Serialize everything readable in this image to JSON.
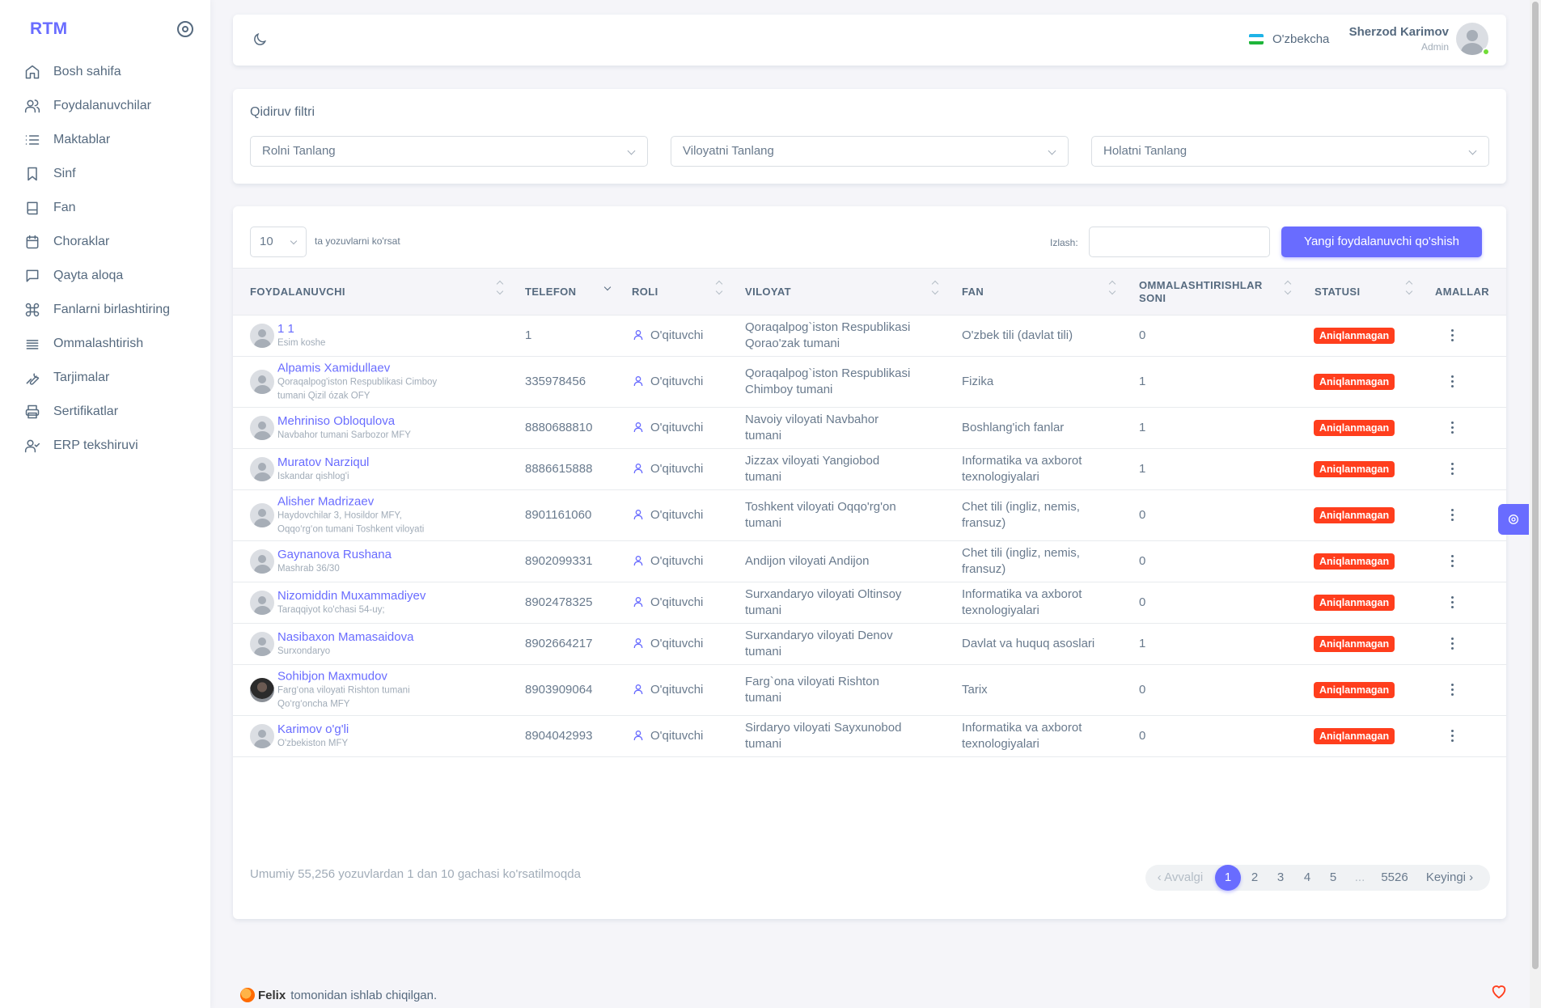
{
  "brand": "RTM",
  "sidebar": {
    "items": [
      {
        "label": "Bosh sahifa",
        "icon": "home-icon"
      },
      {
        "label": "Foydalanuvchilar",
        "icon": "users-icon"
      },
      {
        "label": "Maktablar",
        "icon": "list-icon"
      },
      {
        "label": "Sinf",
        "icon": "bookmark-icon"
      },
      {
        "label": "Fan",
        "icon": "book-icon"
      },
      {
        "label": "Choraklar",
        "icon": "calendar-icon"
      },
      {
        "label": "Qayta aloqa",
        "icon": "message-icon"
      },
      {
        "label": "Fanlarni birlashtiring",
        "icon": "command-icon"
      },
      {
        "label": "Ommalashtirish",
        "icon": "menu-icon"
      },
      {
        "label": "Tarjimalar",
        "icon": "tool-icon"
      },
      {
        "label": "Sertifikatlar",
        "icon": "printer-icon"
      },
      {
        "label": "ERP tekshiruvi",
        "icon": "user-check-icon"
      }
    ]
  },
  "navbar": {
    "language": "O'zbekcha",
    "user_name": "Sherzod Karimov",
    "user_role": "Admin"
  },
  "filters": {
    "title": "Qidiruv filtri",
    "role_placeholder": "Rolni Tanlang",
    "region_placeholder": "Viloyatni Tanlang",
    "status_placeholder": "Holatni Tanlang"
  },
  "table": {
    "page_length": "10",
    "page_length_label": "ta yozuvlarni ko'rsat",
    "search_label": "Izlash:",
    "add_button": "Yangi foydalanuvchi qo'shish",
    "columns": {
      "user": "FOYDALANUVCHI",
      "phone": "TELEFON",
      "role": "ROLI",
      "region": "VILOYAT",
      "subject": "FAN",
      "publications_1": "OMMALASHTIRISHLAR",
      "publications_2": "SONI",
      "status": "STATUSI",
      "actions": "AMALLAR"
    },
    "rows": [
      {
        "name": "1 1",
        "addr1": "Esim koshe",
        "addr2": "",
        "phone": "1",
        "role": "O'qituvchi",
        "region1": "Qoraqalpog`iston Respublikasi",
        "region2": "Qorao'zak tumani",
        "subject1": "O'zbek tili (davlat tili)",
        "subject2": "",
        "count": "0",
        "status": "Aniqlanmagan"
      },
      {
        "name": "Alpamis Xamidullaev",
        "addr1": "Qoraqalpog'iston Respublikasi Cimboy",
        "addr2": "tumani Qizil ózak OFY",
        "phone": "335978456",
        "role": "O'qituvchi",
        "region1": "Qoraqalpog`iston Respublikasi",
        "region2": "Chimboy tumani",
        "subject1": "Fizika",
        "subject2": "",
        "count": "1",
        "status": "Aniqlanmagan"
      },
      {
        "name": "Mehriniso Obloqulova",
        "addr1": "Navbahor tumani Sarbozor MFY",
        "addr2": "",
        "phone": "8880688810",
        "role": "O'qituvchi",
        "region1": "Navoiy viloyati Navbahor",
        "region2": "tumani",
        "subject1": "Boshlang'ich fanlar",
        "subject2": "",
        "count": "1",
        "status": "Aniqlanmagan"
      },
      {
        "name": "Muratov Narziqul",
        "addr1": "Iskandar qishlog'i",
        "addr2": "",
        "phone": "8886615888",
        "role": "O'qituvchi",
        "region1": "Jizzax viloyati Yangiobod",
        "region2": "tumani",
        "subject1": "Informatika va axborot",
        "subject2": "texnologiyalari",
        "count": "1",
        "status": "Aniqlanmagan"
      },
      {
        "name": "Alisher Madrizaev",
        "addr1": "Haydovchilar 3, Hosildor MFY,",
        "addr2": "Oqqo‘rg‘on tumani Toshkent viloyati",
        "phone": "8901161060",
        "role": "O'qituvchi",
        "region1": "Toshkent viloyati Oqqo'rg'on",
        "region2": "tumani",
        "subject1": "Chet tili (ingliz, nemis,",
        "subject2": "fransuz)",
        "count": "0",
        "status": "Aniqlanmagan"
      },
      {
        "name": "Gaynanova Rushana",
        "addr1": "Mashrab 36/30",
        "addr2": "",
        "phone": "8902099331",
        "role": "O'qituvchi",
        "region1": "Andijon viloyati Andijon",
        "region2": "",
        "subject1": "Chet tili (ingliz, nemis,",
        "subject2": "fransuz)",
        "count": "0",
        "status": "Aniqlanmagan"
      },
      {
        "name": "Nizomiddin Muxammadiyev",
        "addr1": "Taraqqiyot ko'chasi 54-uy;",
        "addr2": "",
        "phone": "8902478325",
        "role": "O'qituvchi",
        "region1": "Surxandaryo viloyati Oltinsoy",
        "region2": "tumani",
        "subject1": "Informatika va axborot",
        "subject2": "texnologiyalari",
        "count": "0",
        "status": "Aniqlanmagan"
      },
      {
        "name": "Nasibaxon Mamasaidova",
        "addr1": "Surxondaryo",
        "addr2": "",
        "phone": "8902664217",
        "role": "O'qituvchi",
        "region1": "Surxandaryo viloyati Denov",
        "region2": "tumani",
        "subject1": "Davlat va huquq asoslari",
        "subject2": "",
        "count": "1",
        "status": "Aniqlanmagan"
      },
      {
        "name": "Sohibjon Maxmudov",
        "addr1": "Farg‘ona viloyati Rishton tumani",
        "addr2": "Qo‘rg‘oncha MFY",
        "phone": "8903909064",
        "role": "O'qituvchi",
        "region1": "Farg`ona viloyati Rishton",
        "region2": "tumani",
        "subject1": "Tarix",
        "subject2": "",
        "count": "0",
        "status": "Aniqlanmagan"
      },
      {
        "name": "Karimov o'g'li",
        "addr1": "O'zbekiston MFY",
        "addr2": "",
        "phone": "8904042993",
        "role": "O'qituvchi",
        "region1": "Sirdaryo viloyati Sayxunobod",
        "region2": "tumani",
        "subject1": "Informatika va axborot",
        "subject2": "texnologiyalari",
        "count": "0",
        "status": "Aniqlanmagan"
      }
    ],
    "info": "Umumiy 55,256 yozuvlardan 1 dan 10 gachasi ko'rsatilmoqda"
  },
  "pagination": {
    "prev": "Avvalgi",
    "pages": [
      "1",
      "2",
      "3",
      "4",
      "5",
      "...",
      "5526"
    ],
    "next": "Keyingi",
    "active": "1"
  },
  "footer": {
    "brand": "Felix",
    "text": "tomonidan ishlab chiqilgan."
  },
  "colors": {
    "accent": "#696cff",
    "danger": "#ff3e1d",
    "background": "#f5f5f9"
  }
}
